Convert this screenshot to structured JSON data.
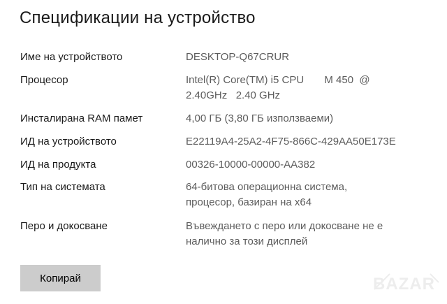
{
  "section": {
    "title": "Спецификации на устройство"
  },
  "specs": [
    {
      "label": "Име на устройството",
      "value": "DESKTOP-Q67CRUR"
    },
    {
      "label": "Процесор",
      "value": "Intel(R) Core(TM) i5 CPU       M 450  @\n2.40GHz   2.40 GHz"
    },
    {
      "label": "Инсталирана RAM памет",
      "value": "4,00 ГБ (3,80 ГБ използваеми)"
    },
    {
      "label": "ИД на устройството",
      "value": "E22119A4-25A2-4F75-866C-429AA50E173E"
    },
    {
      "label": "ИД на продукта",
      "value": "00326-10000-00000-AA382"
    },
    {
      "label": "Тип на системата",
      "value": "64-битова операционна система,\nпроцесор, базиран на x64"
    },
    {
      "label": "Перо и докосване",
      "value": "Въвеждането с перо или докосване не е\nналично за този дисплей"
    }
  ],
  "actions": {
    "copy_label": "Копирай"
  },
  "watermark": {
    "text": "BAZAR"
  }
}
